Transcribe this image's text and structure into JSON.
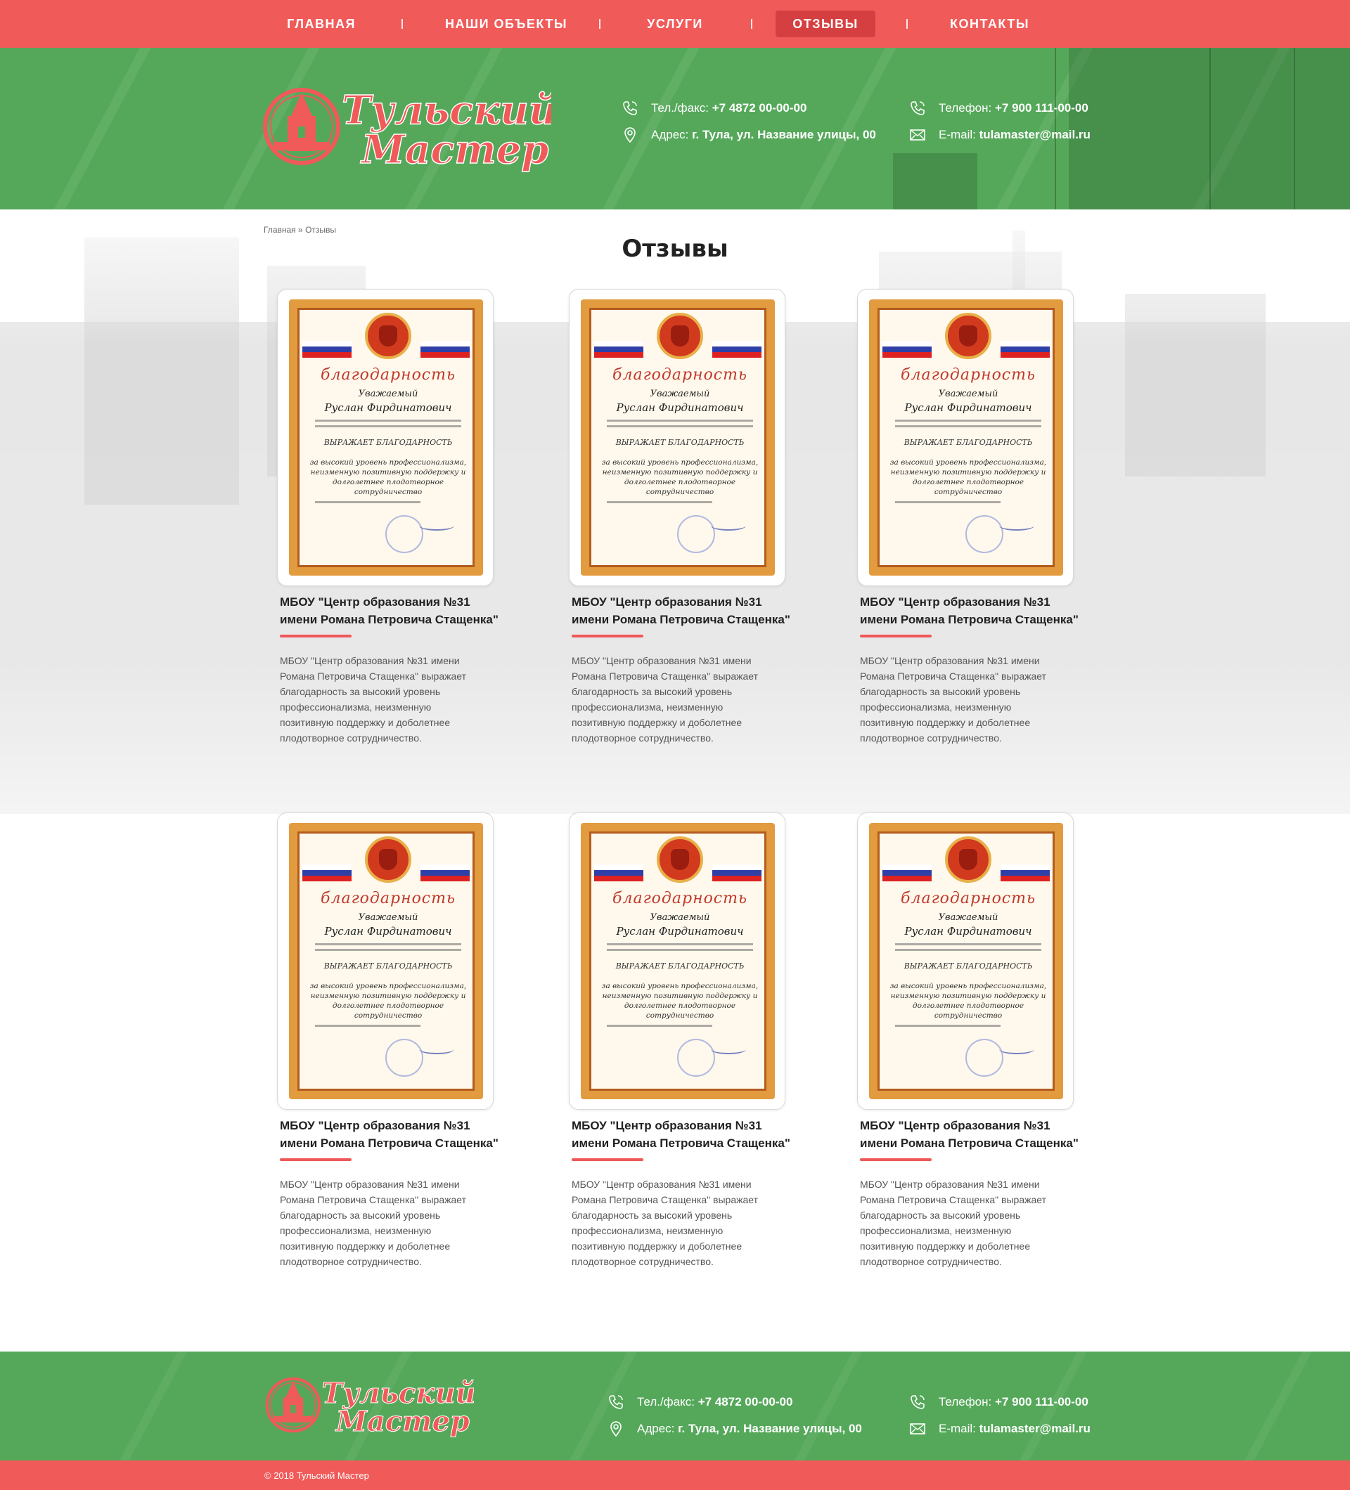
{
  "nav": {
    "items": [
      {
        "label": "ГЛАВНАЯ"
      },
      {
        "label": "НАШИ ОБЪЕКТЫ"
      },
      {
        "label": "УСЛУГИ"
      },
      {
        "label": "ОТЗЫВЫ",
        "active": true
      },
      {
        "label": "КОНТАКТЫ"
      }
    ]
  },
  "brand": {
    "line1": "Тульский",
    "line2": "Мастер",
    "primary_color": "#f05a59",
    "green_color": "#55a85a"
  },
  "contacts": {
    "phone_fax_label": "Тел./факс:",
    "phone_fax_value": "+7 4872 00-00-00",
    "address_label": "Адрес:",
    "address_value": "г. Тула, ул. Название улицы, 00",
    "phone_label": "Телефон:",
    "phone_value": "+7 900 111-00-00",
    "email_label": "E-mail:",
    "email_value": "tulamaster@mail.ru",
    "icons": [
      "phone-icon",
      "location-icon",
      "phone-icon",
      "email-icon"
    ]
  },
  "breadcrumb": {
    "home": "Главная",
    "separator": "»",
    "current": "Отзывы"
  },
  "page_title": "Отзывы",
  "certificate": {
    "heading": "благодарность",
    "greeting": "Уважаемый",
    "name": "Руслан Фирдинатович",
    "thanks_line": "ВЫРАЖАЕТ БЛАГОДАРНОСТЬ",
    "body": "за высокий уровень профессионализма, неизменную позитивную поддержку и долголетнее плодотворное сотрудничество"
  },
  "reviews": [
    {
      "title": "МБОУ \"Центр образования №31 имени Романа Петровича Стащенка\"",
      "text": "МБОУ \"Центр образования №31 имени Романа Петровича Стащенка\" выражает благодарность за высокий уровень профессионализма, неизменную позитивную поддержку и доболетнее плодотворное сотрудничество."
    },
    {
      "title": "МБОУ \"Центр образования №31 имени Романа Петровича Стащенка\"",
      "text": "МБОУ \"Центр образования №31 имени Романа Петровича Стащенка\" выражает благодарность за высокий уровень профессионализма, неизменную позитивную поддержку и доболетнее плодотворное сотрудничество."
    },
    {
      "title": "МБОУ \"Центр образования №31 имени Романа Петровича Стащенка\"",
      "text": "МБОУ \"Центр образования №31 имени Романа Петровича Стащенка\" выражает благодарность за высокий уровень профессионализма, неизменную позитивную поддержку и доболетнее плодотворное сотрудничество."
    },
    {
      "title": "МБОУ \"Центр образования №31 имени Романа Петровича Стащенка\"",
      "text": "МБОУ \"Центр образования №31 имени Романа Петровича Стащенка\" выражает благодарность за высокий уровень профессионализма, неизменную позитивную поддержку и доболетнее плодотворное сотрудничество."
    },
    {
      "title": "МБОУ \"Центр образования №31 имени Романа Петровича Стащенка\"",
      "text": "МБОУ \"Центр образования №31 имени Романа Петровича Стащенка\" выражает благодарность за высокий уровень профессионализма, неизменную позитивную поддержку и доболетнее плодотворное сотрудничество."
    },
    {
      "title": "МБОУ \"Центр образования №31 имени Романа Петровича Стащенка\"",
      "text": "МБОУ \"Центр образования №31 имени Романа Петровича Стащенка\" выражает благодарность за высокий уровень профессионализма, неизменную позитивную поддержку и доболетнее плодотворное сотрудничество."
    }
  ],
  "footer": {
    "copyright": "© 2018  Тульский Мастер"
  }
}
